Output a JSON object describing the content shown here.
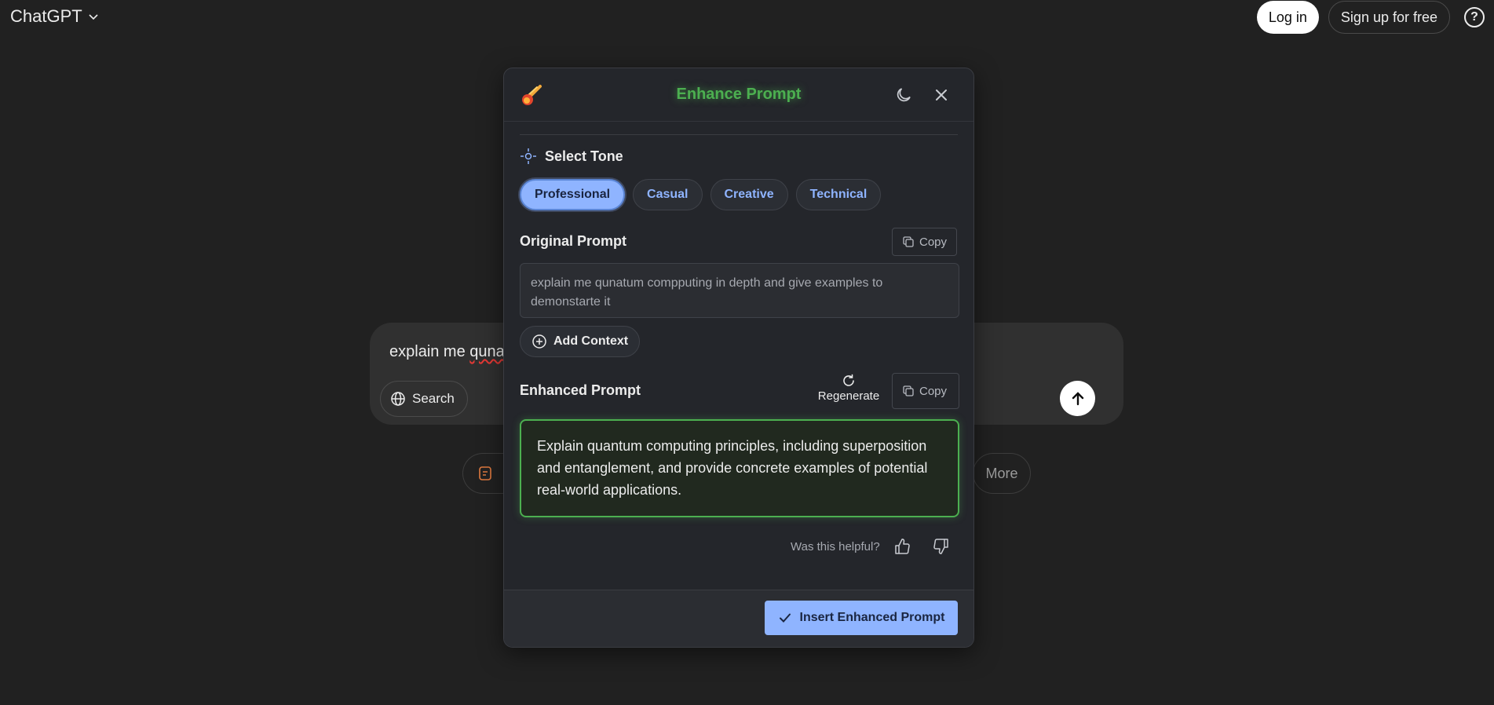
{
  "app": {
    "title": "ChatGPT"
  },
  "header": {
    "login_label": "Log in",
    "signup_label": "Sign up for free",
    "help_glyph": "?"
  },
  "composer": {
    "text_visible": "explain me ",
    "text_misspelled": "quna",
    "search_label": "Search"
  },
  "suggestions": {
    "more_label": "More"
  },
  "modal": {
    "title": "Enhance Prompt",
    "tone_section_label": "Select Tone",
    "tones": [
      {
        "label": "Professional",
        "active": true
      },
      {
        "label": "Casual",
        "active": false
      },
      {
        "label": "Creative",
        "active": false
      },
      {
        "label": "Technical",
        "active": false
      }
    ],
    "original_label": "Original Prompt",
    "copy_label": "Copy",
    "original_text": "explain me qunatum compputing in depth and give examples to demonstarte it",
    "add_context_label": "Add Context",
    "enhanced_label": "Enhanced Prompt",
    "regenerate_label": "Regenerate",
    "enhanced_text": "Explain quantum computing principles, including superposition and entanglement, and provide concrete examples of potential real-world applications.",
    "helpful_label": "Was this helpful?",
    "insert_label": "Insert Enhanced Prompt"
  },
  "colors": {
    "background": "#212121",
    "modal_bg": "#24262b",
    "accent_blue": "#8fb4ff",
    "accent_green": "#4caf50"
  }
}
